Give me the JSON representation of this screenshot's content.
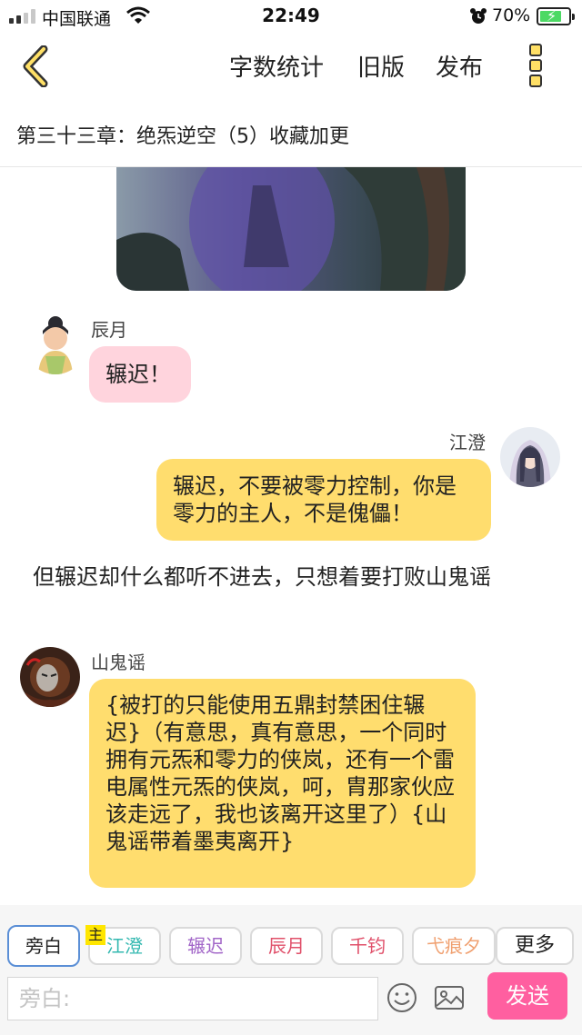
{
  "status_bar": {
    "carrier": "中国联通",
    "time": "22:49",
    "battery_percent": "70%",
    "battery_level": 0.7
  },
  "nav": {
    "back_icon": "chevron-left-icon",
    "word_count": "字数统计",
    "old_version": "旧版",
    "publish": "发布",
    "more_icon": "more-vertical-icon"
  },
  "chapter": {
    "title": "第三十三章：绝炁逆空（5）收藏加更"
  },
  "messages": [
    {
      "speaker": "辰月",
      "text": "辗迟！",
      "side": "left",
      "color": "#ffd4dd"
    },
    {
      "speaker": "江澄",
      "text": "辗迟，不要被零力控制，你是零力的主人，不是傀儡！",
      "side": "right",
      "color": "#ffdd6e"
    },
    {
      "speaker": "",
      "text": "但辗迟却什么都听不进去，只想着要打败山鬼谣",
      "side": "narration"
    },
    {
      "speaker": "山鬼谣",
      "text": "{被打的只能使用五鼎封禁困住辗迟}（有意思，真有意思，一个同时拥有元炁和零力的侠岚，还有一个雷电属性元炁的侠岚，呵，胄那家伙应该走远了，我也该离开这里了）{山鬼谣带着墨夷离开}",
      "side": "left",
      "color": "#ffdd6e"
    }
  ],
  "role_bar": {
    "roles": [
      {
        "label": "旁白",
        "color": "#222222",
        "active": true
      },
      {
        "label": "江澄",
        "color": "#33b8b0",
        "active": false
      },
      {
        "label": "辗迟",
        "color": "#a266c8",
        "active": false
      },
      {
        "label": "辰月",
        "color": "#e0506a",
        "active": false
      },
      {
        "label": "千钧",
        "color": "#e0506a",
        "active": false
      },
      {
        "label": "弋痕夕",
        "color": "#f0a070",
        "active": false
      }
    ],
    "main_tag": "主",
    "more": "更多"
  },
  "composer": {
    "placeholder": "旁白:",
    "emoji_icon": "smiley-icon",
    "image_icon": "image-icon",
    "send": "发送"
  }
}
